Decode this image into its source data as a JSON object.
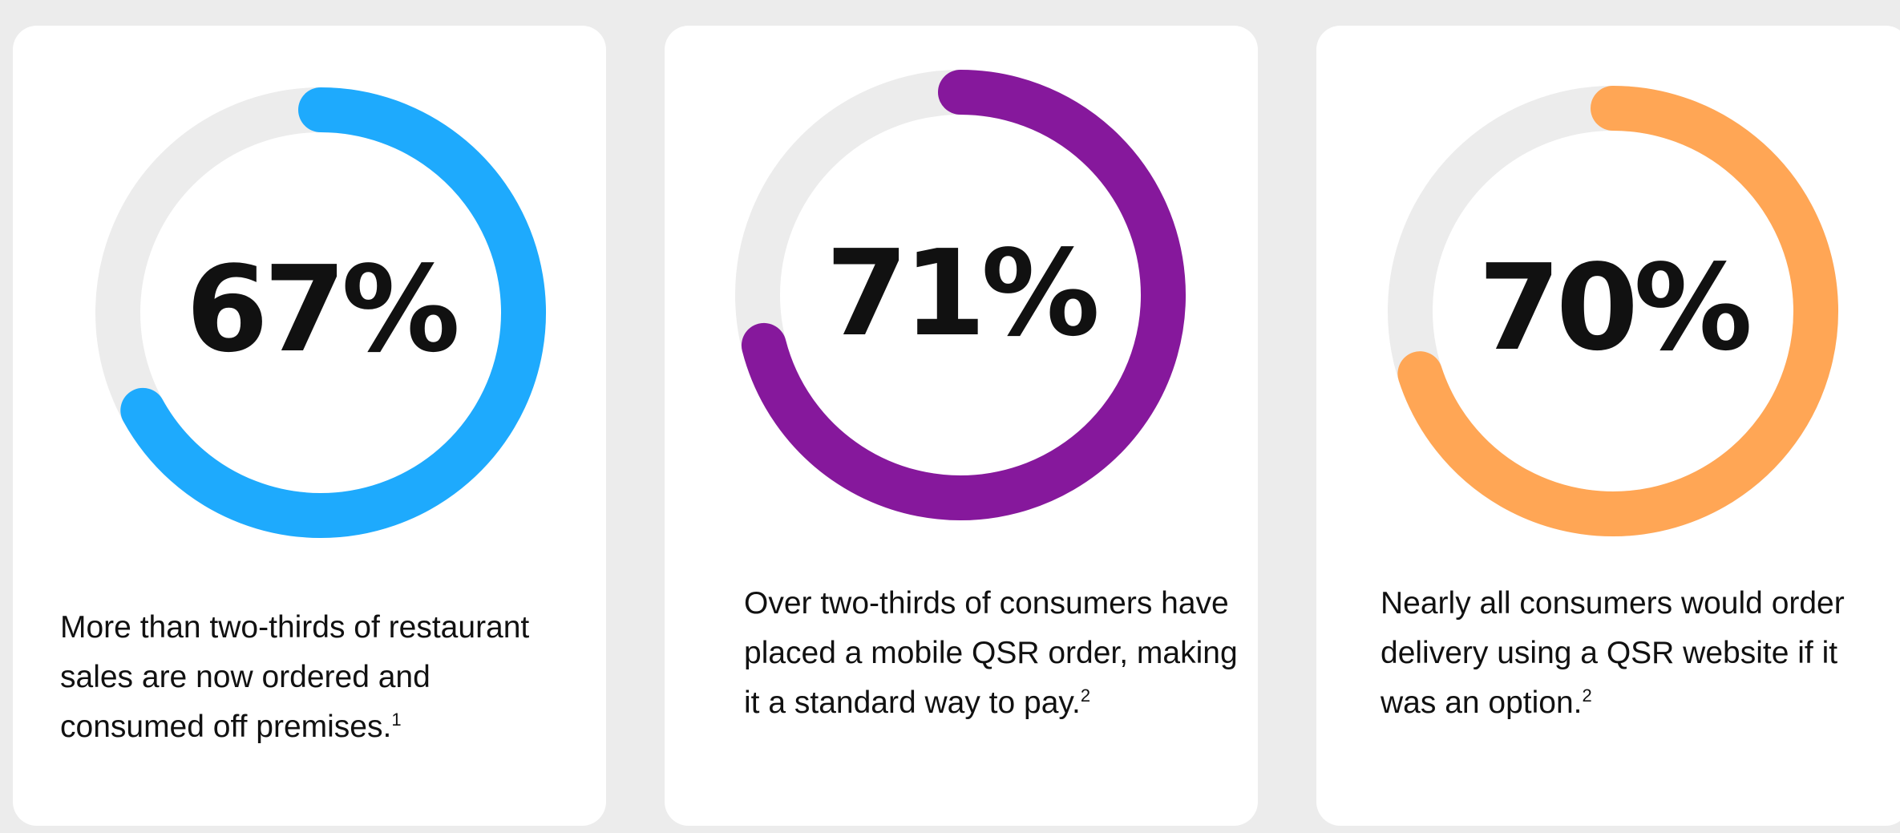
{
  "chart_data": [
    {
      "type": "pie",
      "value": 67,
      "label": "67%",
      "color": "#1eaafd",
      "track_color": "#ececec",
      "description": "More than two-thirds of restaurant sales are now ordered and consumed off premises.",
      "footnote": "1"
    },
    {
      "type": "pie",
      "value": 71,
      "label": "71%",
      "color": "#86189c",
      "track_color": "#ececec",
      "description": "Over two-thirds of consumers have placed a mobile QSR order, making it a standard way to pay.",
      "footnote": "2"
    },
    {
      "type": "pie",
      "value": 70,
      "label": "70%",
      "color": "#ffa655",
      "track_color": "#ececec",
      "description": "Nearly all consumers would order delivery using a QSR website if it was an option.",
      "footnote": "2"
    }
  ]
}
